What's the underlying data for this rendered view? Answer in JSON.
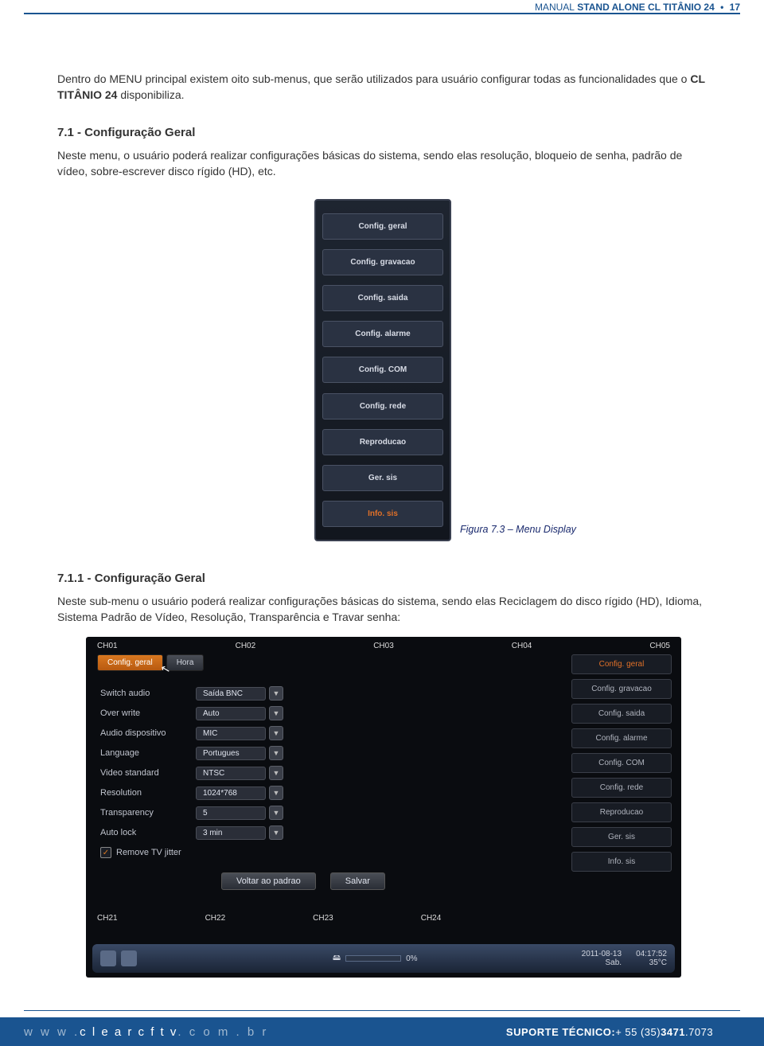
{
  "header": {
    "prefix": "MANUAL",
    "title": "STAND ALONE CL TITÂNIO 24",
    "page": "17"
  },
  "intro": {
    "pre": "Dentro do MENU principal existem oito sub-menus, que serão utilizados para usuário configurar todas as funcionalidades que o ",
    "bold": "CL TITÂNIO 24",
    "post": "  disponibiliza."
  },
  "sec71": {
    "title": "7.1 - Configuração Geral",
    "text": "Neste menu, o usuário poderá realizar configurações básicas do sistema, sendo elas resolução, bloqueio de senha, padrão de vídeo, sobre-escrever disco rígido (HD), etc."
  },
  "fig73": {
    "items": [
      "Config. geral",
      "Config. gravacao",
      "Config. saida",
      "Config. alarme",
      "Config. COM",
      "Config. rede",
      "Reproducao",
      "Ger. sis",
      "Info. sis"
    ],
    "caption": "Figura 7.3 – Menu Display"
  },
  "sec711": {
    "title": "7.1.1 - Configuração Geral",
    "text": "Neste sub-menu o usuário poderá realizar configurações básicas do sistema, sendo elas  Reciclagem do disco rígido (HD), Idioma, Sistema Padrão de Vídeo, Resolução, Transparência e Travar senha:"
  },
  "panel": {
    "ch_top": [
      "CH01",
      "CH02",
      "CH03",
      "CH04",
      "CH05"
    ],
    "tabs": {
      "active": "Config. geral",
      "inactive": "Hora"
    },
    "form": [
      {
        "label": "Switch audio",
        "value": "Saída BNC"
      },
      {
        "label": "Over write",
        "value": "Auto"
      },
      {
        "label": "Audio dispositivo",
        "value": "MIC"
      },
      {
        "label": "Language",
        "value": "Portugues"
      },
      {
        "label": "Video standard",
        "value": "NTSC"
      },
      {
        "label": "Resolution",
        "value": "1024*768"
      },
      {
        "label": "Transparency",
        "value": "5"
      },
      {
        "label": "Auto lock",
        "value": "3 min"
      }
    ],
    "checkbox": "Remove TV jitter",
    "buttons": {
      "reset": "Voltar ao padrao",
      "save": "Salvar"
    },
    "side": [
      "Config. geral",
      "Config. gravacao",
      "Config. saida",
      "Config. alarme",
      "Config. COM",
      "Config. rede",
      "Reproducao",
      "Ger. sis",
      "Info. sis"
    ],
    "ch_bot": [
      "CH21",
      "CH22",
      "CH23",
      "CH24"
    ],
    "taskbar": {
      "disk": "0%",
      "date": "2011-08-13",
      "day": "Sab.",
      "time": "04:17:52",
      "temp": "35°C"
    }
  },
  "footer": {
    "url_pre": "w w w .",
    "url_mid": "c l e a r c f t v",
    "url_post": ". c o m . b r",
    "support_label": "SUPORTE TÉCNICO:",
    "support_num_pre": " + 55 (35) ",
    "support_num_bold": "3471",
    "support_num_post": ".7073"
  }
}
